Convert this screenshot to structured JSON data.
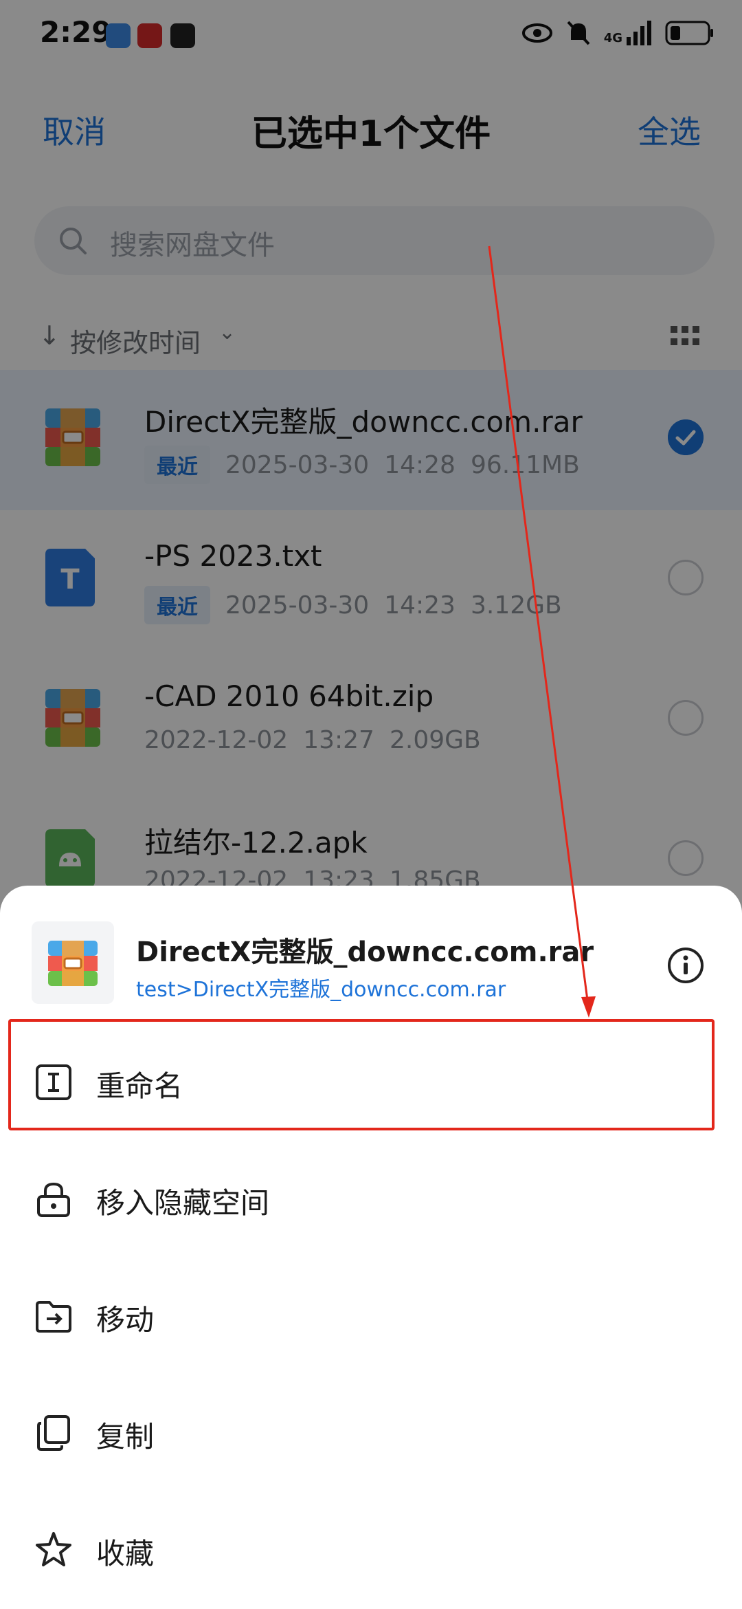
{
  "status_bar": {
    "time": "2:29",
    "app_icons": [
      "cloud-app-icon",
      "news-app-icon",
      "bird-app-icon"
    ],
    "indicators": [
      "eye-icon",
      "mute-bell-icon",
      "signal-4g-icon",
      "battery-icon"
    ],
    "network": "4G"
  },
  "topbar": {
    "cancel_label": "取消",
    "title": "已选中1个文件",
    "select_all_label": "全选"
  },
  "search": {
    "placeholder": "搜索网盘文件"
  },
  "sort": {
    "label": "按修改时间"
  },
  "files": [
    {
      "name": "DirectX完整版_downcc.com.rar",
      "badge": "最近",
      "date": "2025-03-30",
      "time": "14:28",
      "size": "96.11MB",
      "type": "rar",
      "selected": true
    },
    {
      "name": "-PS 2023.txt",
      "badge": "最近",
      "date": "2025-03-30",
      "time": "14:23",
      "size": "3.12GB",
      "type": "txt",
      "selected": false
    },
    {
      "name": "-CAD 2010 64bit.zip",
      "badge": "",
      "date": "2022-12-02",
      "time": "13:27",
      "size": "2.09GB",
      "type": "zip",
      "selected": false
    },
    {
      "name": "拉结尔-12.2.apk",
      "badge": "",
      "date": "2022-12-02",
      "time": "13:23",
      "size": "1.85GB",
      "type": "apk",
      "selected": false
    }
  ],
  "sheet": {
    "file_name": "DirectX完整版_downcc.com.rar",
    "file_path": "test>DirectX完整版_downcc.com.rar",
    "menu": [
      {
        "label": "重命名",
        "icon": "rename-icon"
      },
      {
        "label": "移入隐藏空间",
        "icon": "lock-icon"
      },
      {
        "label": "移动",
        "icon": "move-folder-icon"
      },
      {
        "label": "复制",
        "icon": "copy-icon"
      },
      {
        "label": "收藏",
        "icon": "star-icon"
      }
    ]
  },
  "colors": {
    "accent": "#1E73D8",
    "annotation_red": "#E3271B"
  }
}
